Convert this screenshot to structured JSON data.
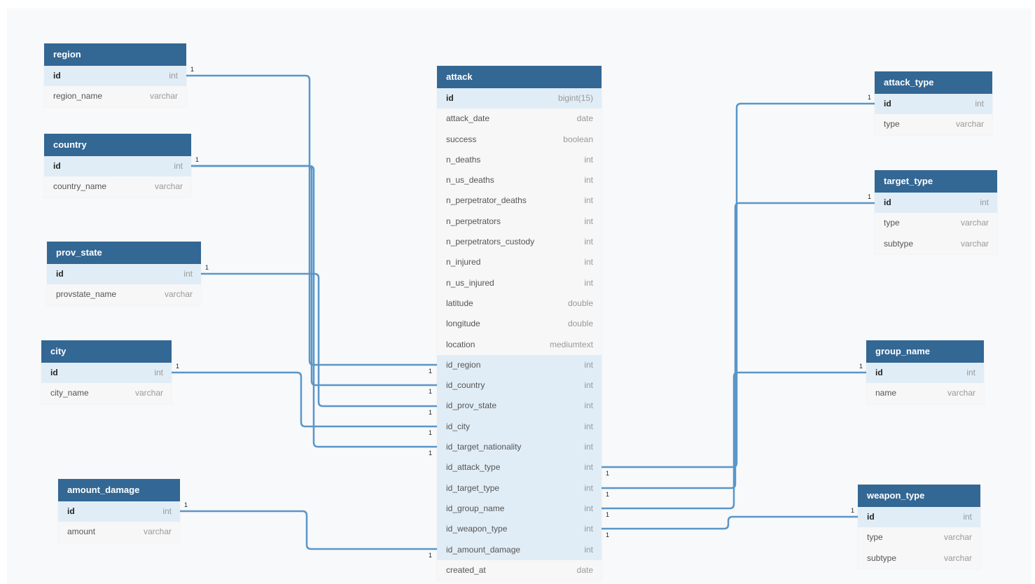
{
  "tables": {
    "region": {
      "name": "region",
      "columns": [
        {
          "name": "id",
          "type": "int",
          "pk": true
        },
        {
          "name": "region_name",
          "type": "varchar"
        }
      ]
    },
    "country": {
      "name": "country",
      "columns": [
        {
          "name": "id",
          "type": "int",
          "pk": true
        },
        {
          "name": "country_name",
          "type": "varchar"
        }
      ]
    },
    "prov_state": {
      "name": "prov_state",
      "columns": [
        {
          "name": "id",
          "type": "int",
          "pk": true
        },
        {
          "name": "provstate_name",
          "type": "varchar"
        }
      ]
    },
    "city": {
      "name": "city",
      "columns": [
        {
          "name": "id",
          "type": "int",
          "pk": true
        },
        {
          "name": "city_name",
          "type": "varchar"
        }
      ]
    },
    "amount_damage": {
      "name": "amount_damage",
      "columns": [
        {
          "name": "id",
          "type": "int",
          "pk": true
        },
        {
          "name": "amount",
          "type": "varchar"
        }
      ]
    },
    "attack": {
      "name": "attack",
      "columns": [
        {
          "name": "id",
          "type": "bigint(15)",
          "pk": true
        },
        {
          "name": "attack_date",
          "type": "date"
        },
        {
          "name": "success",
          "type": "boolean"
        },
        {
          "name": "n_deaths",
          "type": "int"
        },
        {
          "name": "n_us_deaths",
          "type": "int"
        },
        {
          "name": "n_perpetrator_deaths",
          "type": "int"
        },
        {
          "name": "n_perpetrators",
          "type": "int"
        },
        {
          "name": "n_perpetrators_custody",
          "type": "int"
        },
        {
          "name": "n_injured",
          "type": "int"
        },
        {
          "name": "n_us_injured",
          "type": "int"
        },
        {
          "name": "latitude",
          "type": "double"
        },
        {
          "name": "longitude",
          "type": "double"
        },
        {
          "name": "location",
          "type": "mediumtext"
        },
        {
          "name": "id_region",
          "type": "int",
          "fk": true
        },
        {
          "name": "id_country",
          "type": "int",
          "fk": true
        },
        {
          "name": "id_prov_state",
          "type": "int",
          "fk": true
        },
        {
          "name": "id_city",
          "type": "int",
          "fk": true
        },
        {
          "name": "id_target_nationality",
          "type": "int",
          "fk": true
        },
        {
          "name": "id_attack_type",
          "type": "int",
          "fk": true
        },
        {
          "name": "id_target_type",
          "type": "int",
          "fk": true
        },
        {
          "name": "id_group_name",
          "type": "int",
          "fk": true
        },
        {
          "name": "id_weapon_type",
          "type": "int",
          "fk": true
        },
        {
          "name": "id_amount_damage",
          "type": "int",
          "fk": true
        },
        {
          "name": "created_at",
          "type": "date"
        }
      ]
    },
    "attack_type": {
      "name": "attack_type",
      "columns": [
        {
          "name": "id",
          "type": "int",
          "pk": true
        },
        {
          "name": "type",
          "type": "varchar"
        }
      ]
    },
    "target_type": {
      "name": "target_type",
      "columns": [
        {
          "name": "id",
          "type": "int",
          "pk": true
        },
        {
          "name": "type",
          "type": "varchar"
        },
        {
          "name": "subtype",
          "type": "varchar"
        }
      ]
    },
    "group_name": {
      "name": "group_name",
      "columns": [
        {
          "name": "id",
          "type": "int",
          "pk": true
        },
        {
          "name": "name",
          "type": "varchar"
        }
      ]
    },
    "weapon_type": {
      "name": "weapon_type",
      "columns": [
        {
          "name": "id",
          "type": "int",
          "pk": true
        },
        {
          "name": "type",
          "type": "varchar"
        },
        {
          "name": "subtype",
          "type": "varchar"
        }
      ]
    }
  },
  "relationships": [
    {
      "from": "region",
      "to_column": "id_region",
      "from_card": "1",
      "to_card": "1"
    },
    {
      "from": "country",
      "to_column": "id_country",
      "from_card": "1",
      "to_card": "1"
    },
    {
      "from": "prov_state",
      "to_column": "id_prov_state",
      "from_card": "1",
      "to_card": "1"
    },
    {
      "from": "city",
      "to_column": "id_city",
      "from_card": "1",
      "to_card": "1"
    },
    {
      "from": "country",
      "to_column": "id_target_nationality",
      "from_card": "1",
      "to_card": "1"
    },
    {
      "from": "amount_damage",
      "to_column": "id_amount_damage",
      "from_card": "1",
      "to_card": "1"
    },
    {
      "from": "attack_type",
      "to_column": "id_attack_type",
      "from_card": "1",
      "to_card": "1"
    },
    {
      "from": "target_type",
      "to_column": "id_target_type",
      "from_card": "1",
      "to_card": "1"
    },
    {
      "from": "group_name",
      "to_column": "id_group_name",
      "from_card": "1",
      "to_card": "1"
    },
    {
      "from": "weapon_type",
      "to_column": "id_weapon_type",
      "from_card": "1",
      "to_card": "1"
    }
  ],
  "colors": {
    "header": "#336794",
    "key_row": "#e1edf6",
    "link": "#5a96c8"
  }
}
